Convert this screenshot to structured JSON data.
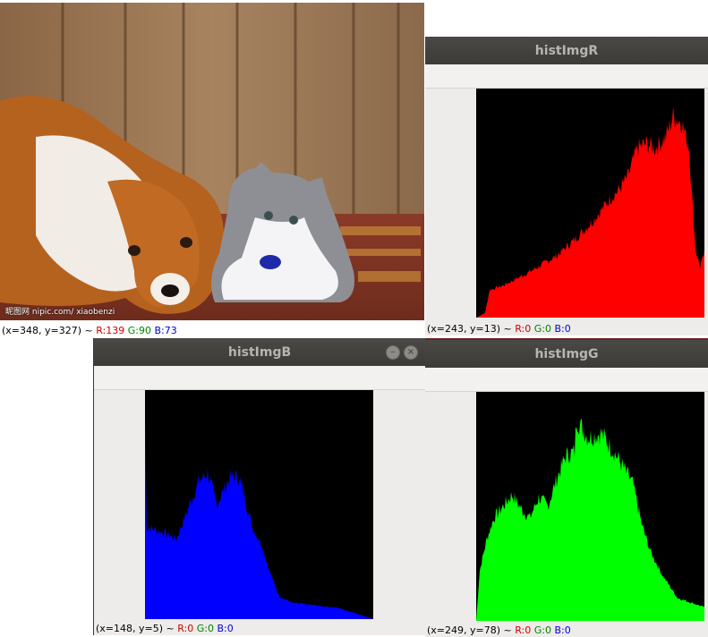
{
  "photo_window": {
    "watermark": "昵图网 nipic.com/ xiaobenzi",
    "status": {
      "prefix": "(x=348, y=327) ~ ",
      "r": "R:139",
      "g": "G:90",
      "b": "B:73"
    }
  },
  "windows": {
    "hist_r": {
      "title": "histImgR",
      "status": {
        "prefix": "(x=243, y=13) ~ ",
        "r": "R:0",
        "g": "G:0",
        "b": "B:0"
      }
    },
    "hist_b": {
      "title": "histImgB",
      "status": {
        "prefix": "(x=148, y=5) ~ ",
        "r": "R:0",
        "g": "G:0",
        "b": "B:0"
      }
    },
    "hist_g": {
      "title": "histImgG",
      "status": {
        "prefix": "(x=249, y=78) ~ ",
        "r": "R:0",
        "g": "G:0",
        "b": "B:0"
      }
    }
  },
  "colors": {
    "red": "#ff0000",
    "green": "#00ff00",
    "blue": "#0000ff",
    "plot_bg": "#000000"
  },
  "histograms": {
    "r": {
      "color": "#ff0000",
      "points": [
        [
          0,
          0
        ],
        [
          10,
          0.02
        ],
        [
          15,
          0.12
        ],
        [
          30,
          0.14
        ],
        [
          60,
          0.2
        ],
        [
          90,
          0.27
        ],
        [
          110,
          0.34
        ],
        [
          130,
          0.42
        ],
        [
          150,
          0.52
        ],
        [
          160,
          0.56
        ],
        [
          170,
          0.62
        ],
        [
          180,
          0.74
        ],
        [
          190,
          0.76
        ],
        [
          200,
          0.74
        ],
        [
          212,
          0.79
        ],
        [
          220,
          0.88
        ],
        [
          230,
          0.85
        ],
        [
          238,
          0.74
        ],
        [
          240,
          0.6
        ],
        [
          245,
          0.3
        ],
        [
          250,
          0.22
        ],
        [
          255,
          0.28
        ]
      ]
    },
    "g": {
      "color": "#00ff00",
      "points": [
        [
          0,
          0
        ],
        [
          4,
          0.22
        ],
        [
          12,
          0.36
        ],
        [
          20,
          0.45
        ],
        [
          30,
          0.5
        ],
        [
          40,
          0.55
        ],
        [
          52,
          0.48
        ],
        [
          60,
          0.45
        ],
        [
          70,
          0.54
        ],
        [
          80,
          0.5
        ],
        [
          90,
          0.62
        ],
        [
          100,
          0.72
        ],
        [
          110,
          0.74
        ],
        [
          112,
          0.88
        ],
        [
          125,
          0.8
        ],
        [
          140,
          0.82
        ],
        [
          160,
          0.7
        ],
        [
          175,
          0.6
        ],
        [
          185,
          0.42
        ],
        [
          195,
          0.3
        ],
        [
          208,
          0.2
        ],
        [
          225,
          0.1
        ],
        [
          255,
          0.06
        ]
      ]
    },
    "b": {
      "color": "#0000ff",
      "points": [
        [
          0,
          0.88
        ],
        [
          2,
          0.4
        ],
        [
          20,
          0.38
        ],
        [
          35,
          0.35
        ],
        [
          50,
          0.5
        ],
        [
          60,
          0.6
        ],
        [
          70,
          0.64
        ],
        [
          80,
          0.5
        ],
        [
          95,
          0.62
        ],
        [
          105,
          0.62
        ],
        [
          110,
          0.55
        ],
        [
          120,
          0.4
        ],
        [
          130,
          0.33
        ],
        [
          140,
          0.2
        ],
        [
          150,
          0.1
        ],
        [
          165,
          0.07
        ],
        [
          190,
          0.06
        ],
        [
          215,
          0.05
        ],
        [
          240,
          0.02
        ],
        [
          255,
          0
        ]
      ]
    }
  }
}
